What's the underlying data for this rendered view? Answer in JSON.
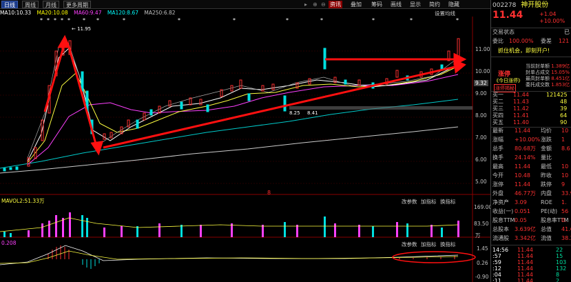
{
  "toolbar": {
    "tabs": [
      "日线",
      "周线",
      "月线",
      "更多周期"
    ],
    "active_tab": 0,
    "buttons": [
      "资讯",
      "叠加",
      "筹码",
      "画线",
      "显示",
      "简约",
      "隐藏"
    ],
    "arrows": [
      "▸",
      "⊕",
      "⊖"
    ]
  },
  "ma_line": {
    "items": [
      {
        "label": "MA10:10.33",
        "color": "#ffffff"
      },
      {
        "label": "MA20:10.08",
        "color": "#ffff00"
      },
      {
        "label": "MA60:9.47",
        "color": "#ff40ff"
      },
      {
        "label": "MA120:8.67",
        "color": "#00ffff"
      },
      {
        "label": "MA250:6.82",
        "color": "#c0c0c0"
      }
    ],
    "setting": "设置均线"
  },
  "price_axis": [
    "11.00",
    "10.00",
    "9.32",
    "9.00",
    "8.00",
    "7.00",
    "6.00",
    "5.00"
  ],
  "annotations": {
    "high": "11.95",
    "low_a": "8.25",
    "low_b": "8.41",
    "mid": "9.32",
    "note": "8"
  },
  "volume": {
    "label": "MAVOL2:51.33万",
    "buttons": [
      "改参数",
      "加指标",
      "换指标"
    ],
    "axis": [
      "169.00",
      "83.50",
      "万"
    ]
  },
  "macd": {
    "label": "0.208",
    "buttons": [
      "改参数",
      "加指标",
      "换指标"
    ],
    "axis": [
      "1.45",
      "0.26",
      "-0.90"
    ]
  },
  "panel": {
    "code": "002278",
    "name": "神开股份",
    "price": "11.44",
    "change": "+1.04",
    "change_pct": "+10.00%",
    "status_label": "交易状态",
    "status_val": "已",
    "weibi_label": "委比",
    "weibi_val": "100.00%",
    "weicha_label": "委差",
    "weicha_val": "121",
    "promo": "抓住机会，即刻开户!",
    "fengban_title": "涨停",
    "fengban_sub1": "《今日涨停》",
    "fengban_sub2": "涨停揭秘",
    "fengban_rows": [
      [
        "当前封单额",
        "1.389亿"
      ],
      [
        "封单占成交",
        "15.05%"
      ],
      [
        "最高封单额",
        "8.451亿"
      ],
      [
        "委托成交数",
        "1.853亿"
      ]
    ],
    "buy": [
      [
        "买一",
        "11.44",
        "121425"
      ],
      [
        "买二",
        "11.43",
        "48"
      ],
      [
        "买三",
        "11.42",
        "39"
      ],
      [
        "买四",
        "11.41",
        "64"
      ],
      [
        "买五",
        "11.40",
        "90"
      ]
    ],
    "stats": [
      [
        "最新",
        "11.44",
        "均价",
        "10"
      ],
      [
        "涨幅",
        "+10.00%",
        "涨跌",
        "1"
      ],
      [
        "总手",
        "80.68万",
        "金额",
        "8.6"
      ],
      [
        "换手",
        "24.14%",
        "量比",
        ""
      ],
      [
        "最高",
        "11.44",
        "最低",
        "10"
      ],
      [
        "今开",
        "10.48",
        "昨收",
        "10"
      ],
      [
        "涨停",
        "11.44",
        "跌停",
        "9"
      ],
      [
        "外盘",
        "46.77万",
        "内盘",
        "33.9"
      ],
      [
        "净资产",
        "3.09",
        "ROE",
        "1."
      ],
      [
        "收益(一)",
        "0.051",
        "PE(动)",
        "56"
      ],
      [
        "股息TTM",
        "0.05",
        "股息率TTM",
        "0."
      ],
      [
        "总股本",
        "3.639亿",
        "总值",
        "41.6"
      ],
      [
        "流通股",
        "3.342亿",
        "流值",
        "38.2"
      ]
    ],
    "ticks": [
      [
        "14:56",
        "11.44",
        "22"
      ],
      [
        ":57",
        "11.44",
        "15"
      ],
      [
        ":59",
        "11.44",
        "103"
      ],
      [
        ":12",
        "11.44",
        "132"
      ],
      [
        ":04",
        "11.44",
        "8"
      ],
      [
        ":11",
        "11.44",
        "2"
      ]
    ]
  }
}
